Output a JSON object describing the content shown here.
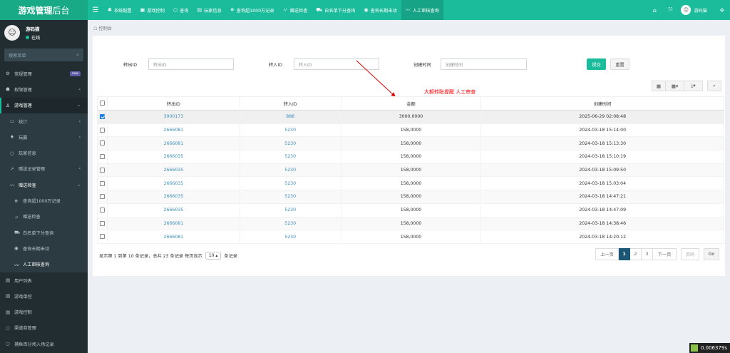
{
  "header": {
    "logo_bold": "游戏管理",
    "logo_thin": "后台",
    "nav": [
      {
        "icon": "✱",
        "label": "系统配置"
      },
      {
        "icon": "▣",
        "label": "游戏控制"
      },
      {
        "icon": "○",
        "label": "查询"
      },
      {
        "icon": "▤",
        "label": "玩家信息"
      },
      {
        "icon": "✵",
        "label": "查询超1000万记录"
      },
      {
        "icon": "〃",
        "label": "赠送检查"
      },
      {
        "icon": "⛟",
        "label": "白名单下分查询"
      },
      {
        "icon": "◉",
        "label": "查询长期未动"
      },
      {
        "icon": "〰",
        "label": "人工审核查询"
      }
    ],
    "username": "游码猫"
  },
  "sidebar": {
    "user_name": "游码猫",
    "status": "在线",
    "search_placeholder": "搜索菜单",
    "badge_new": "new",
    "items": [
      {
        "icon": "⚙",
        "label": "常规管理",
        "arrow": ""
      },
      {
        "icon": "☗",
        "label": "权限管理",
        "arrow": "‹"
      },
      {
        "icon": "♙",
        "label": "游戏管理",
        "arrow": "⌄"
      },
      {
        "icon": "▭",
        "label": "统计",
        "arrow": "‹"
      },
      {
        "icon": "♦",
        "label": "玩赢",
        "arrow": "‹"
      },
      {
        "icon": "○",
        "label": "玩家信息",
        "arrow": ""
      },
      {
        "icon": "↗",
        "label": "赠送记录管理",
        "arrow": "‹"
      },
      {
        "icon": "〰",
        "label": "赠送检查",
        "arrow": "⌄"
      },
      {
        "icon": "✵",
        "label": "查询超1000万记录",
        "arrow": ""
      },
      {
        "icon": "〃",
        "label": "赠送检查",
        "arrow": ""
      },
      {
        "icon": "⛟",
        "label": "白名单下分查询",
        "arrow": ""
      },
      {
        "icon": "◉",
        "label": "查询长期未动",
        "arrow": ""
      },
      {
        "icon": "〰",
        "label": "人工审核查询",
        "arrow": ""
      },
      {
        "icon": "▤",
        "label": "用户列表",
        "arrow": ""
      },
      {
        "icon": "▤",
        "label": "游戏单控",
        "arrow": ""
      },
      {
        "icon": "▤",
        "label": "游戏控制",
        "arrow": ""
      },
      {
        "icon": "○",
        "label": "渠道商管理",
        "arrow": ""
      },
      {
        "icon": "○",
        "label": "捕鱼百分场入场记录",
        "arrow": ""
      }
    ]
  },
  "breadcrumb": "控制台",
  "filters": {
    "out_label": "转出ID",
    "out_placeholder": "转出ID",
    "in_label": "转入ID",
    "in_placeholder": "转入ID",
    "time_label": "创建时间",
    "time_placeholder": "创建时间",
    "submit": "提交",
    "reset": "重置"
  },
  "toolbar": {
    "toggle_icon": "▦",
    "columns_icon": "▦▾",
    "export_icon": "⤓▾",
    "search_icon": "⌕"
  },
  "annotation": "大额转账提醒 人工审查",
  "table": {
    "headers": [
      "转出ID",
      "转入ID",
      "金额",
      "创建时间"
    ],
    "rows": [
      {
        "checked": true,
        "out": "3000173",
        "in": "888",
        "amount": "3000,0000",
        "time": "2025-06-29 02:08:48"
      },
      {
        "checked": false,
        "out": "2666081",
        "in": "5230",
        "amount": "158,0000",
        "time": "2024-03-18 15:14:00"
      },
      {
        "checked": false,
        "out": "2666081",
        "in": "5230",
        "amount": "158,0000",
        "time": "2024-03-18 15:13:30"
      },
      {
        "checked": false,
        "out": "2666035",
        "in": "5230",
        "amount": "158,0000",
        "time": "2024-03-18 15:10:19"
      },
      {
        "checked": false,
        "out": "2666035",
        "in": "5230",
        "amount": "158,0000",
        "time": "2024-03-18 15:09:50"
      },
      {
        "checked": false,
        "out": "2666035",
        "in": "5230",
        "amount": "158,0000",
        "time": "2024-03-18 15:03:04"
      },
      {
        "checked": false,
        "out": "2666035",
        "in": "5230",
        "amount": "158,0000",
        "time": "2024-03-18 14:47:21"
      },
      {
        "checked": false,
        "out": "2666035",
        "in": "5230",
        "amount": "158,0000",
        "time": "2024-03-18 14:47:09"
      },
      {
        "checked": false,
        "out": "2666081",
        "in": "5230",
        "amount": "158,0000",
        "time": "2024-03-18 14:38:46"
      },
      {
        "checked": false,
        "out": "2666081",
        "in": "5230",
        "amount": "158,0000",
        "time": "2024-03-18 14:20:12"
      }
    ]
  },
  "pagination": {
    "info_prefix": "显示第 1 到第 10 条记录，总共 23 条记录 每页显示",
    "page_size": "10",
    "info_suffix": "条记录",
    "prev": "上一页",
    "pages": [
      "1",
      "2",
      "3"
    ],
    "next": "下一页",
    "page_input_placeholder": "页码",
    "go": "Go"
  },
  "perf": "0.006379s",
  "colors": {
    "brand": "#1bbc9b",
    "sidebar": "#222d32",
    "link": "#3c8dbc",
    "annotation": "#ff0000"
  }
}
